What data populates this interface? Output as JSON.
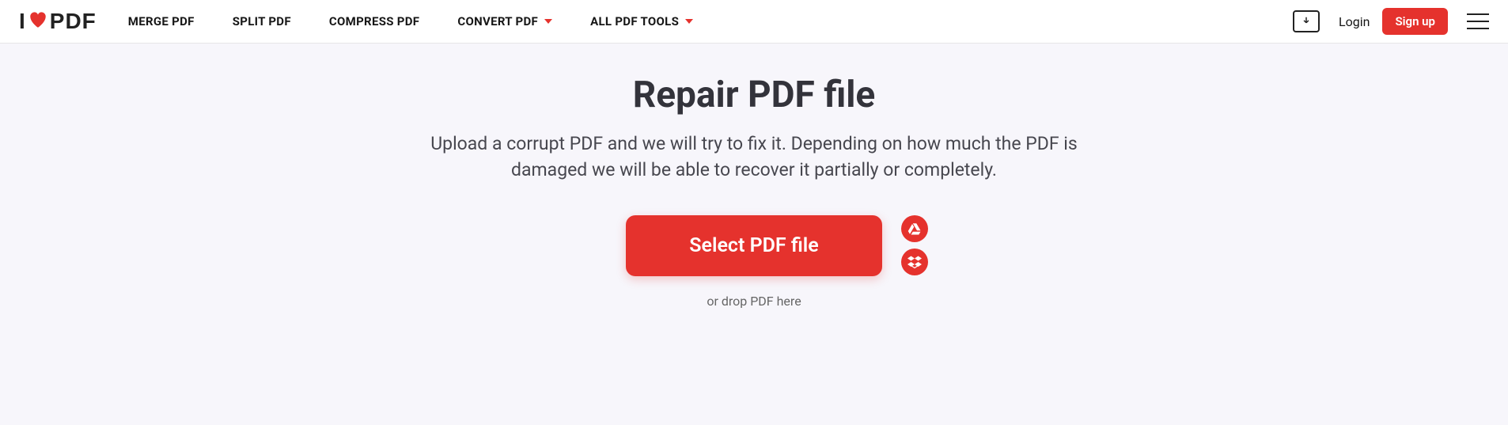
{
  "logo": {
    "left": "I",
    "right": "PDF"
  },
  "nav": {
    "merge": "MERGE PDF",
    "split": "SPLIT PDF",
    "compress": "COMPRESS PDF",
    "convert": "CONVERT PDF",
    "all": "ALL PDF TOOLS"
  },
  "auth": {
    "login": "Login",
    "signup": "Sign up"
  },
  "page": {
    "title": "Repair PDF file",
    "subtitle": "Upload a corrupt PDF and we will try to fix it. Depending on how much the PDF is damaged we will be able to recover it partially or completely.",
    "select_btn": "Select PDF file",
    "drop": "or drop PDF here"
  }
}
